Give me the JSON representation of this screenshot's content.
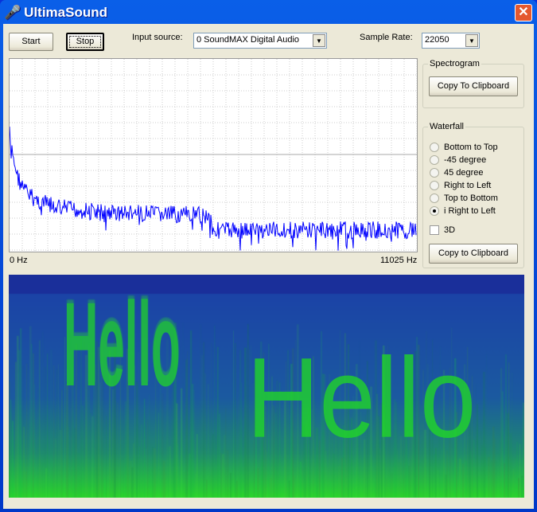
{
  "window": {
    "title": "UltimaSound",
    "icon": "microphone-icon"
  },
  "toolbar": {
    "start": "Start",
    "stop": "Stop",
    "input_source_label": "Input source:",
    "input_source_value": "0 SoundMAX Digital Audio",
    "sample_rate_label": "Sample Rate:",
    "sample_rate_value": "22050"
  },
  "spectrum": {
    "x_min_label": "0 Hz",
    "x_max_label": "11025 Hz",
    "trace_color": "#0000ff"
  },
  "spectrogram_group": {
    "label": "Spectrogram",
    "copy": "Copy To Clipboard"
  },
  "waterfall_group": {
    "label": "Waterfall",
    "options": [
      "Bottom to Top",
      "-45 degree",
      "45 degree",
      "Right to Left",
      "Top to Bottom",
      "i Right to Left"
    ],
    "selected": 5,
    "checkbox_3d": "3D",
    "checkbox_3d_checked": false,
    "copy": "Copy to Clipboard"
  },
  "waterfall": {
    "text_1": "Hello",
    "text_2": "Hello",
    "bg_color": "#1a4fa8",
    "signal_color": "#22dd22"
  }
}
